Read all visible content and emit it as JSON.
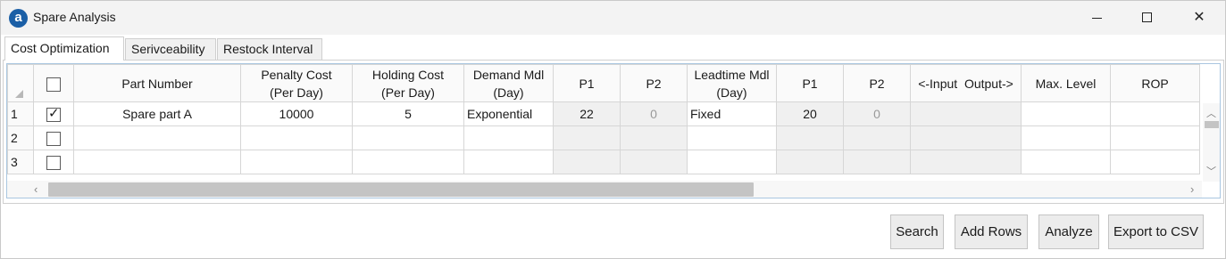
{
  "window": {
    "title": "Spare Analysis",
    "app_icon_glyph": "a",
    "controls": [
      "minimize-icon",
      "maximize-icon",
      "close-icon"
    ]
  },
  "tabs": [
    {
      "label": "Cost Optimization",
      "active": true
    },
    {
      "label": "Serivceability",
      "active": false
    },
    {
      "label": "Restock Interval",
      "active": false
    }
  ],
  "grid": {
    "columns": [
      {
        "l1": "",
        "l2": ""
      },
      {
        "l1": "Part Number",
        "l2": ""
      },
      {
        "l1": "Penalty Cost",
        "l2": "(Per Day)"
      },
      {
        "l1": "Holding Cost",
        "l2": "(Per Day)"
      },
      {
        "l1": "Demand Mdl",
        "l2": "(Day)"
      },
      {
        "l1": "P1",
        "l2": ""
      },
      {
        "l1": "P2",
        "l2": ""
      },
      {
        "l1": "Leadtime Mdl",
        "l2": "(Day)"
      },
      {
        "l1": "P1",
        "l2": ""
      },
      {
        "l1": "P2",
        "l2": ""
      },
      {
        "l1": "<-Input  Output->",
        "l2": ""
      },
      {
        "l1": "Max. Level",
        "l2": ""
      },
      {
        "l1": "ROP",
        "l2": ""
      }
    ],
    "rows": [
      {
        "num": "1",
        "checked": true,
        "part": "Spare part A",
        "penalty": "10000",
        "holding": "5",
        "demand_mdl": "Exponential",
        "d_p1": "22",
        "d_p2": "0",
        "lead_mdl": "Fixed",
        "l_p1": "20",
        "l_p2": "0",
        "sep": "",
        "max_level": "",
        "rop": ""
      },
      {
        "num": "2",
        "checked": false,
        "part": "",
        "penalty": "",
        "holding": "",
        "demand_mdl": "",
        "d_p1": "",
        "d_p2": "",
        "lead_mdl": "",
        "l_p1": "",
        "l_p2": "",
        "sep": "",
        "max_level": "",
        "rop": ""
      },
      {
        "num": "3",
        "checked": false,
        "part": "",
        "penalty": "",
        "holding": "",
        "demand_mdl": "",
        "d_p1": "",
        "d_p2": "",
        "lead_mdl": "",
        "l_p1": "",
        "l_p2": "",
        "sep": "",
        "max_level": "",
        "rop": ""
      }
    ]
  },
  "buttons": {
    "search": "Search",
    "add_rows": "Add Rows",
    "analyze": "Analyze",
    "export": "Export to CSV"
  },
  "colors": {
    "app_icon": "#1b5fa6",
    "grid_frame": "#a9c6e0",
    "disabled_text": "#9a9a9a"
  }
}
